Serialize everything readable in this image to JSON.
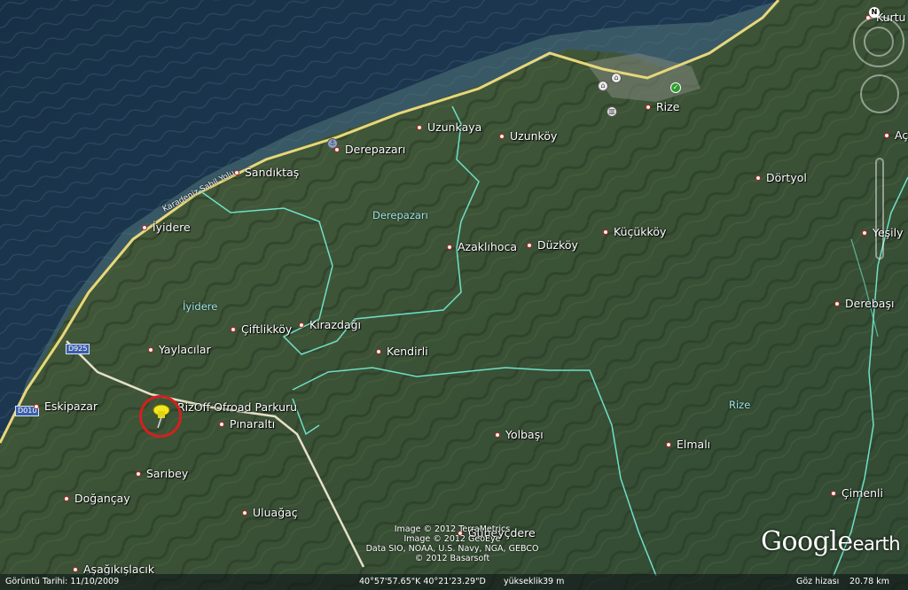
{
  "places": [
    {
      "name": "Rize",
      "key": "rize"
    },
    {
      "name": "Uzunkaya",
      "key": "uzunkaya"
    },
    {
      "name": "Uzunköy",
      "key": "uzunkoy"
    },
    {
      "name": "Derepazarı",
      "key": "derepazari"
    },
    {
      "name": "Sandıktaş",
      "key": "sandiktas"
    },
    {
      "name": "İyidere",
      "key": "iyidere"
    },
    {
      "name": "Dörtyol",
      "key": "dortyol"
    },
    {
      "name": "Azaklıhoca",
      "key": "azaklihoca"
    },
    {
      "name": "Düzköy",
      "key": "duzkoy"
    },
    {
      "name": "Küçükköy",
      "key": "kucukkoy"
    },
    {
      "name": "Yeşily",
      "key": "yesily"
    },
    {
      "name": "Derebaşı",
      "key": "derebasi"
    },
    {
      "name": "Çiftlikköy",
      "key": "ciftlikkoy"
    },
    {
      "name": "Kirazdağı",
      "key": "kirazdagi"
    },
    {
      "name": "Yaylacılar",
      "key": "yaylacilar"
    },
    {
      "name": "Kendirli",
      "key": "kendirli"
    },
    {
      "name": "Eskipazar",
      "key": "eskipazar"
    },
    {
      "name": "RizOff Ofroad Parkuru",
      "key": "rizoff"
    },
    {
      "name": "Pınaraltı",
      "key": "pinaralti"
    },
    {
      "name": "Yolbaşı",
      "key": "yolbasi"
    },
    {
      "name": "Elmalı",
      "key": "elmali"
    },
    {
      "name": "Sarıbey",
      "key": "saribey"
    },
    {
      "name": "Doğançay",
      "key": "dogancay"
    },
    {
      "name": "Uluağaç",
      "key": "uluagac"
    },
    {
      "name": "Çimenli",
      "key": "cimenli"
    },
    {
      "name": "Aşağıkışlacık",
      "key": "asagikislacik"
    },
    {
      "name": "Kurtu",
      "key": "kurtu"
    },
    {
      "name": "Aç",
      "key": "ac"
    },
    {
      "name": "Güneyçdere",
      "key": "guneydere"
    }
  ],
  "regions": {
    "derepazari": "Derepazarı",
    "iyidere": "İyidere",
    "rize": "Rize"
  },
  "roads": {
    "d925": "D925",
    "d010": "D010",
    "coastal": "Karadeniz Sahil Yolu"
  },
  "credits": {
    "line1": "Image © 2012 TerraMetrics",
    "line2": "Image © 2012 GeoEye",
    "line3": "Data SIO, NOAA, U.S. Navy, NGA, GEBCO",
    "line4": "© 2012 Basarsoft"
  },
  "logo": {
    "google": "Google",
    "earth": "earth"
  },
  "status": {
    "imagery_date": "Görüntü Tarihi: 11/10/2009",
    "coordinates": "40°57'57.65\"K  40°21'23.29\"D",
    "elevation_label": "yükseklik",
    "elevation_value": "39 m",
    "eye_label": "Göz hizası",
    "eye_value": "20.78 km"
  },
  "colors": {
    "sea": "#1f3a52",
    "land": "#3c5236",
    "coastal_road": "#e8d77a",
    "border": "#6fe0c8",
    "marker": "#d32020",
    "pin": "#f2e81e"
  },
  "icons": {
    "pushpin": "yellow-pushpin-icon",
    "compass": "compass-ring-icon",
    "zoom": "zoom-slider-icon"
  }
}
